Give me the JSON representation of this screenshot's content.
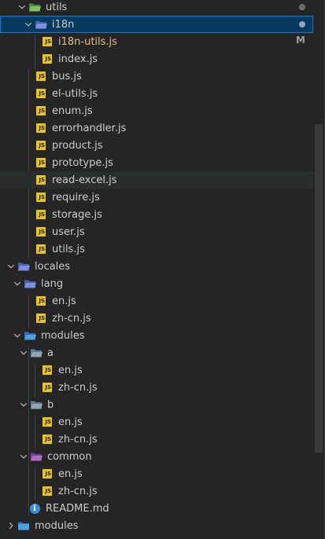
{
  "explorer": {
    "accent": "#04395e",
    "js_icon_color": "#e8c415",
    "items": [
      {
        "label": "utils",
        "type": "folder",
        "open": true,
        "icon": "folder-open-utils-icon",
        "dot": true
      },
      {
        "label": "i18n",
        "type": "folder",
        "open": true,
        "icon": "folder-open-i18n-icon",
        "dot": true,
        "selected": true
      },
      {
        "label": "i18n-utils.js",
        "type": "file",
        "icon": "js-file-icon",
        "modified": true,
        "badge": "M"
      },
      {
        "label": "index.js",
        "type": "file",
        "icon": "js-file-icon"
      },
      {
        "label": "bus.js",
        "type": "file",
        "icon": "js-file-icon"
      },
      {
        "label": "el-utils.js",
        "type": "file",
        "icon": "js-file-icon"
      },
      {
        "label": "enum.js",
        "type": "file",
        "icon": "js-file-icon"
      },
      {
        "label": "errorhandler.js",
        "type": "file",
        "icon": "js-file-icon"
      },
      {
        "label": "product.js",
        "type": "file",
        "icon": "js-file-icon"
      },
      {
        "label": "prototype.js",
        "type": "file",
        "icon": "js-file-icon"
      },
      {
        "label": "read-excel.js",
        "type": "file",
        "icon": "js-file-icon",
        "hover": true
      },
      {
        "label": "require.js",
        "type": "file",
        "icon": "js-file-icon"
      },
      {
        "label": "storage.js",
        "type": "file",
        "icon": "js-file-icon"
      },
      {
        "label": "user.js",
        "type": "file",
        "icon": "js-file-icon"
      },
      {
        "label": "utils.js",
        "type": "file",
        "icon": "js-file-icon"
      },
      {
        "label": "locales",
        "type": "folder",
        "open": true,
        "icon": "folder-open-i18n-icon"
      },
      {
        "label": "lang",
        "type": "folder",
        "open": true,
        "icon": "folder-open-i18n-icon"
      },
      {
        "label": "en.js",
        "type": "file",
        "icon": "js-file-icon"
      },
      {
        "label": "zh-cn.js",
        "type": "file",
        "icon": "js-file-icon"
      },
      {
        "label": "modules",
        "type": "folder",
        "open": true,
        "icon": "folder-open-modules-icon"
      },
      {
        "label": "a",
        "type": "folder",
        "open": true,
        "icon": "folder-open-icon"
      },
      {
        "label": "en.js",
        "type": "file",
        "icon": "js-file-icon"
      },
      {
        "label": "zh-cn.js",
        "type": "file",
        "icon": "js-file-icon"
      },
      {
        "label": "b",
        "type": "folder",
        "open": true,
        "icon": "folder-open-icon"
      },
      {
        "label": "en.js",
        "type": "file",
        "icon": "js-file-icon"
      },
      {
        "label": "zh-cn.js",
        "type": "file",
        "icon": "js-file-icon"
      },
      {
        "label": "common",
        "type": "folder",
        "open": true,
        "icon": "folder-open-common-icon"
      },
      {
        "label": "en.js",
        "type": "file",
        "icon": "js-file-icon"
      },
      {
        "label": "zh-cn.js",
        "type": "file",
        "icon": "js-file-icon"
      },
      {
        "label": "README.md",
        "type": "file",
        "icon": "info-file-icon"
      },
      {
        "label": "modules",
        "type": "folder",
        "open": false,
        "icon": "folder-closed-modules-icon"
      }
    ]
  }
}
